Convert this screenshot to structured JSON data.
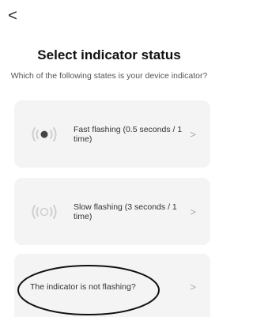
{
  "nav": {
    "back_glyph": "<",
    "back_icon": "chevron-left-icon"
  },
  "title": "Select indicator status",
  "subtitle": "Which of the following states is your device indicator?",
  "options": [
    {
      "label": "Fast flashing (0.5 seconds / 1 time)",
      "icon": "fast-flash-icon",
      "chevron": ">"
    },
    {
      "label": "Slow flashing (3 seconds / 1 time)",
      "icon": "slow-flash-icon",
      "chevron": ">"
    },
    {
      "label": "The indicator is not flashing?",
      "icon": "",
      "chevron": ">"
    }
  ],
  "colors": {
    "card_background": "#f4f4f4",
    "icon_gray": "#cfcfcf",
    "icon_dark": "#444444",
    "annotation": "#111111"
  }
}
